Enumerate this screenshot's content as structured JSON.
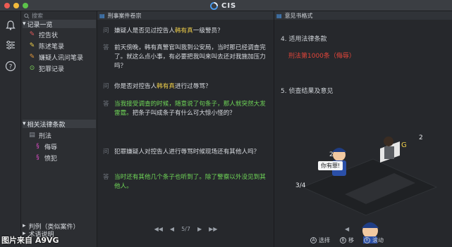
{
  "app": {
    "title": "CIS"
  },
  "sidebar": {
    "search_placeholder": "搜索",
    "records_header": "记录一览",
    "records": [
      {
        "label": "控告状",
        "icon": "complaint-icon"
      },
      {
        "label": "陈述笔录",
        "icon": "statement-icon"
      },
      {
        "label": "嫌疑人讯问笔录",
        "icon": "suspect-icon"
      },
      {
        "label": "犯罪记录",
        "icon": "crime-record-icon"
      }
    ],
    "law_header": "相关法律条款",
    "law_tree": {
      "root": "刑法",
      "children": [
        "侮辱",
        "愤犯"
      ]
    },
    "bottom": [
      "判例（类似案件）",
      "术语说明"
    ]
  },
  "center": {
    "header": "刑事案件卷宗",
    "qa": [
      {
        "tag": "问",
        "parts": [
          "嫌疑人是否见过控告人",
          "韩有真",
          "一级警员？"
        ],
        "type": "q"
      },
      {
        "tag": "答",
        "text": "前天傍晚，韩有真警官叫我到公安局，当时那已经调查完了。就这么点小事，有必要把我叫来叫去还对我施加压力吗？",
        "type": "a"
      },
      {
        "tag": "问",
        "parts": [
          "你是否对控告人",
          "韩有真",
          "进行过辱骂？"
        ],
        "type": "q"
      },
      {
        "tag": "答",
        "text": "当我接受调查的时候，随意说了句条子，那人就突然大发雷霆。把条子叫成条子有什么可大惊小怪的？",
        "type": "a",
        "green_part": "当我接受调查的时候，随意说了句条子，那人就突然大发雷霆。",
        "rest": "把条子叫成条子有什么可大惊小怪的？"
      },
      {
        "tag": "问",
        "text": "犯罪嫌疑人对控告人进行辱骂时候现场还有其他人吗？",
        "type": "q"
      },
      {
        "tag": "答",
        "text": "当时还有其他几个条子也听到了。除了警察以外没见到其他人。",
        "type": "a-green"
      }
    ],
    "pager": {
      "current": "5",
      "total": "7",
      "label": "5/7"
    }
  },
  "right": {
    "header": "意见书格式",
    "item4": "4. 适用法律条款",
    "law_ref": "刑法第1000条（侮辱）",
    "item5": "5. 侦查结果及意见",
    "speech": "你有罪!"
  },
  "hints": [
    {
      "key": "A",
      "label": "选择"
    },
    {
      "key": "B",
      "label": "移"
    },
    {
      "key": "R",
      "label": "滚动"
    }
  ],
  "watermark": "图片来自 A9VG",
  "colors": {
    "accent_yellow": "#f0cf4a",
    "answer_green": "#6fd657",
    "law_red": "#e2453a"
  }
}
